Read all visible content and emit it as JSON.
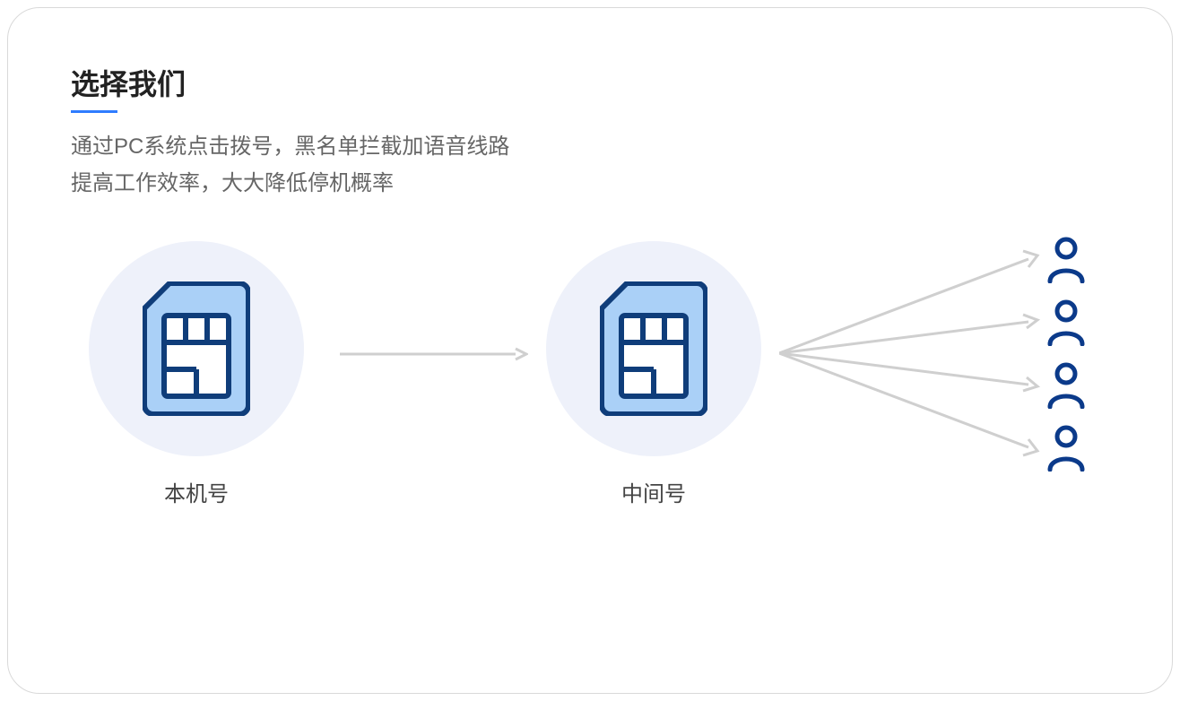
{
  "title": "选择我们",
  "desc_line1": "通过PC系统点击拨号，黑名单拦截加语音线路",
  "desc_line2": "提高工作效率，大大降低停机概率",
  "label_local": "本机号",
  "label_middle": "中间号"
}
